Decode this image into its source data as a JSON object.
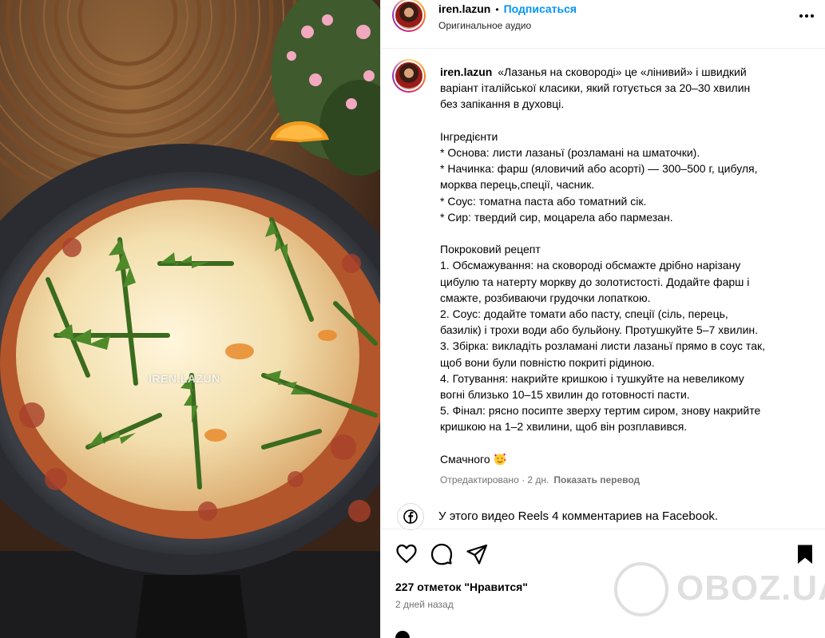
{
  "media": {
    "watermark": "IREN.LAZUN"
  },
  "header": {
    "username": "iren.lazun",
    "separator": "•",
    "follow_label": "Подписаться",
    "audio_label": "Оригинальное аудио"
  },
  "caption": {
    "username": "iren.lazun",
    "lines": [
      "«Лазанья на сковороді» це «лінивий» і швидкий",
      "варіант італійської класики, який готується за 20–30 хвилин",
      "без запікання в духовці.",
      "",
      "Інгредієнти",
      "* Основа: листи лазаньї (розламані на шматочки).",
      "* Начинка: фарш (яловичий або асорті) — 300–500 г, цибуля,",
      "морква перець,спеції, часник.",
      "* Соус: томатна паста або томатний сік.",
      "* Сир: твердий сир, моцарела або пармезан.",
      "",
      "Покроковий рецепт",
      "1. Обсмажування: на сковороді обсмажте дрібно нарізану",
      "цибулю та натерту моркву до золотистості. Додайте фарш і",
      "смажте, розбиваючи грудочки лопаткою.",
      "2. Соус: додайте томати або пасту, спеції (сіль, перець,",
      "базилік) і трохи води або бульйону. Протушкуйте 5–7 хвилин.",
      "3. Збірка: викладіть розламані листи лазаньї прямо в соус так,",
      "щоб вони були повністю покриті рідиною.",
      "4. Готування: накрийте кришкою і тушкуйте на невеликому",
      "вогні близько 10–15 хвилин до готовності пасти.",
      "5. Фінал: рясно посипте зверху тертим сиром, знову накрийте",
      "кришкою на 1–2 хвилини, щоб він розплавився.",
      "",
      "Смачного"
    ],
    "edited": "Отредактировано · 2 дн.",
    "translate_label": "Показать перевод"
  },
  "facebook": {
    "text": "У этого видео Reels 4 комментариев на Facebook."
  },
  "actions": {
    "icons": [
      "heart-icon",
      "comment-icon",
      "share-icon",
      "bookmark-icon"
    ]
  },
  "likes_text": "227 отметок \"Нравится\"",
  "time_ago": "2 дней назад",
  "watermark_site": "OBOZ.UA",
  "colors": {
    "accent": "#0095f6",
    "secondary_text": "#737373",
    "border": "#efefef"
  }
}
